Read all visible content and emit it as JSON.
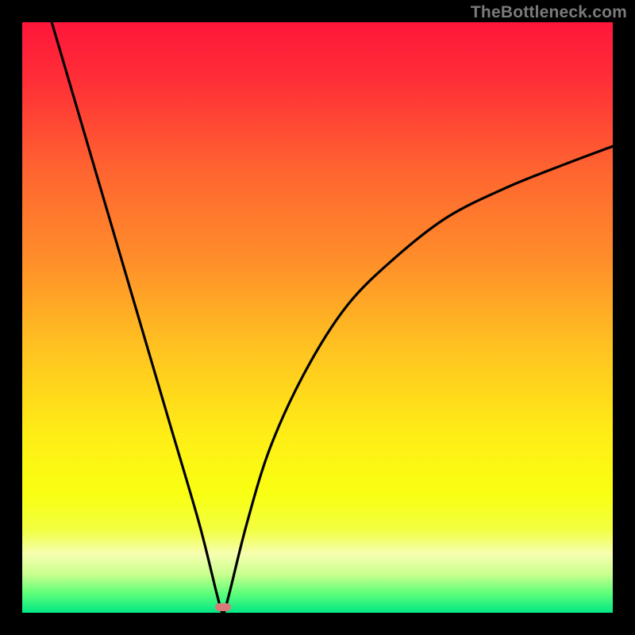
{
  "watermark": "TheBottleneck.com",
  "colors": {
    "background_black": "#000000",
    "curve": "#000000",
    "marker": "#d77a78",
    "gradient_stops": [
      {
        "offset": 0.0,
        "color": "#ff163a"
      },
      {
        "offset": 0.1,
        "color": "#ff2f37"
      },
      {
        "offset": 0.25,
        "color": "#ff6430"
      },
      {
        "offset": 0.4,
        "color": "#ff8d2a"
      },
      {
        "offset": 0.55,
        "color": "#ffc221"
      },
      {
        "offset": 0.7,
        "color": "#ffee16"
      },
      {
        "offset": 0.8,
        "color": "#f9ff12"
      },
      {
        "offset": 0.86,
        "color": "#f2ff42"
      },
      {
        "offset": 0.9,
        "color": "#f6ffb0"
      },
      {
        "offset": 0.935,
        "color": "#c9ff8e"
      },
      {
        "offset": 0.965,
        "color": "#65ff7a"
      },
      {
        "offset": 1.0,
        "color": "#00e884"
      }
    ]
  },
  "chart_data": {
    "type": "line",
    "title": "",
    "xlabel": "",
    "ylabel": "",
    "x_range": [
      0,
      100
    ],
    "y_range": [
      0,
      100
    ],
    "minimum_at_x": 34,
    "marker": {
      "x": 34,
      "y": 1
    },
    "series": [
      {
        "name": "bottleneck-curve",
        "points": [
          {
            "x": 5,
            "y": 100
          },
          {
            "x": 10,
            "y": 83
          },
          {
            "x": 15,
            "y": 66
          },
          {
            "x": 20,
            "y": 49
          },
          {
            "x": 25,
            "y": 32
          },
          {
            "x": 30,
            "y": 15
          },
          {
            "x": 33,
            "y": 3
          },
          {
            "x": 34,
            "y": 0
          },
          {
            "x": 35,
            "y": 3
          },
          {
            "x": 38,
            "y": 15
          },
          {
            "x": 42,
            "y": 28
          },
          {
            "x": 48,
            "y": 41
          },
          {
            "x": 55,
            "y": 52
          },
          {
            "x": 63,
            "y": 60
          },
          {
            "x": 72,
            "y": 67
          },
          {
            "x": 82,
            "y": 72
          },
          {
            "x": 92,
            "y": 76
          },
          {
            "x": 100,
            "y": 79
          }
        ]
      }
    ]
  }
}
